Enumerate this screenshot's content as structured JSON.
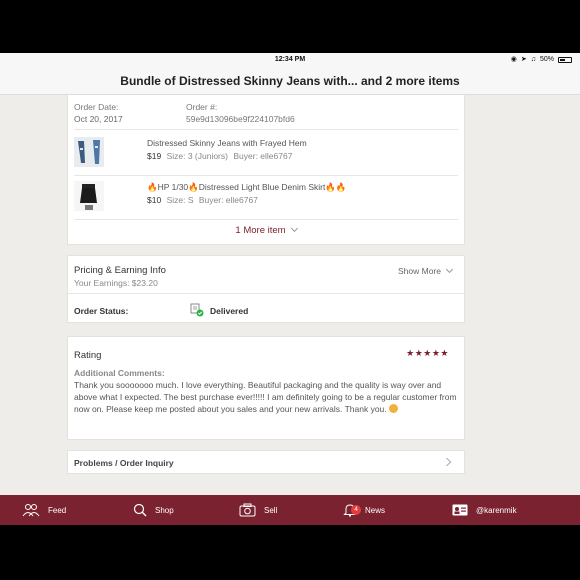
{
  "status_bar": {
    "time": "12:34 PM",
    "battery": "50%"
  },
  "header": {
    "title": "Bundle of Distressed Skinny Jeans with... and 2 more items"
  },
  "order": {
    "date_label": "Order Date:",
    "date": "Oct 20, 2017",
    "number_label": "Order #:",
    "number": "59e9d13096be9f224107bfd6"
  },
  "items": [
    {
      "title": "Distressed Skinny Jeans with Frayed Hem",
      "price": "$19",
      "size": "Size: 3 (Juniors)",
      "buyer": "Buyer: elle6767"
    },
    {
      "title": "🔥HP 1/30🔥Distressed Light Blue Denim Skirt🔥🔥",
      "price": "$10",
      "size": "Size: S",
      "buyer": "Buyer: elle6767"
    }
  ],
  "more_items": "1 More item",
  "pricing": {
    "title": "Pricing & Earning Info",
    "earnings": "Your Earnings: $23.20",
    "show_more": "Show More"
  },
  "order_status": {
    "label": "Order Status:",
    "value": "Delivered"
  },
  "rating": {
    "title": "Rating",
    "stars": "★★★★★",
    "stars_value": 5,
    "comments_label": "Additional Comments:",
    "comments": "Thank you sooooooo much. I love everything. Beautiful packaging and the quality is way over and above what I expected. The best purchase ever!!!!! I am definitely going to be a regular customer from now on. Please keep me posted about you sales and your new arrivals. Thank you."
  },
  "problems": {
    "label": "Problems / Order Inquiry"
  },
  "tabbar": {
    "feed": "Feed",
    "shop": "Shop",
    "sell": "Sell",
    "news": "News",
    "news_badge": "4",
    "user": "@karenmik"
  },
  "colors": {
    "brand": "#7a2230",
    "accent": "#7a1f2b",
    "delivered": "#2bb24c"
  }
}
